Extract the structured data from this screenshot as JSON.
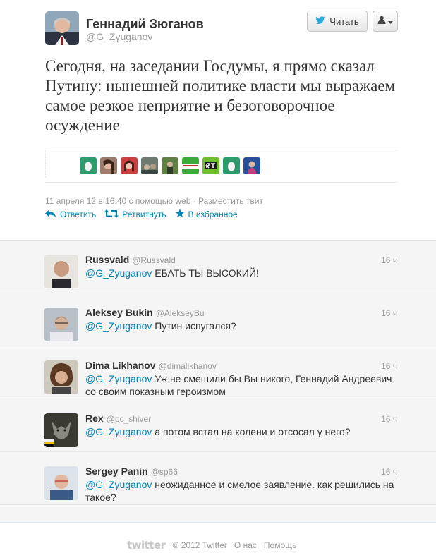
{
  "profile": {
    "name": "Геннадий Зюганов",
    "handle": "@G_Zyuganov",
    "follow_label": "Читать"
  },
  "tweet": {
    "text": "Сегодня, на заседании Госдумы, я прямо сказал Путину: нынешней политике власти мы выражаем самое резкое неприятие и безоговорочное осуждение",
    "meta": "11 апреля 12 в 16:40 с помощью web · Разместить твит",
    "actions": {
      "reply": "Ответить",
      "retweet": "Ретвитнуть",
      "favorite": "В избранное"
    },
    "faces": [
      "egg",
      "photo-woman",
      "photo-woman-red",
      "photo-crowd",
      "photo-outdoor",
      "logo-news",
      "logo-rt",
      "egg",
      "photo-blue"
    ]
  },
  "replies": [
    {
      "name": "Russvald",
      "handle": "@Russvald",
      "time": "16 ч",
      "mention": "@G_Zyuganov",
      "text": " ЕБАТЬ ТЫ ВЫСОКИЙ!"
    },
    {
      "name": "Aleksey Bukin",
      "handle": "@AlekseyBu",
      "time": "16 ч",
      "mention": "@G_Zyuganov",
      "text": " Путин испугался?"
    },
    {
      "name": "Dima Likhanov",
      "handle": "@dimalikhanov",
      "time": "16 ч",
      "mention": "@G_Zyuganov",
      "text": " Уж не смешили бы Вы никого, Геннадий Андреевич со своим показным героизмом"
    },
    {
      "name": "Rex",
      "handle": "@pc_shiver",
      "time": "16 ч",
      "mention": "@G_Zyuganov",
      "text": " а потом встал на колени и отсосал у него?"
    },
    {
      "name": "Sergey Panin",
      "handle": "@sp66",
      "time": "16 ч",
      "mention": "@G_Zyuganov",
      "text": " неожиданное и смелое заявление. как решились на такое?"
    }
  ],
  "footer": {
    "logo": "twitter",
    "copyright": "© 2012 Twitter",
    "about": "О нас",
    "help": "Помощь"
  },
  "colors": {
    "link": "#0084b4",
    "muted": "#999999",
    "text": "#333333"
  }
}
